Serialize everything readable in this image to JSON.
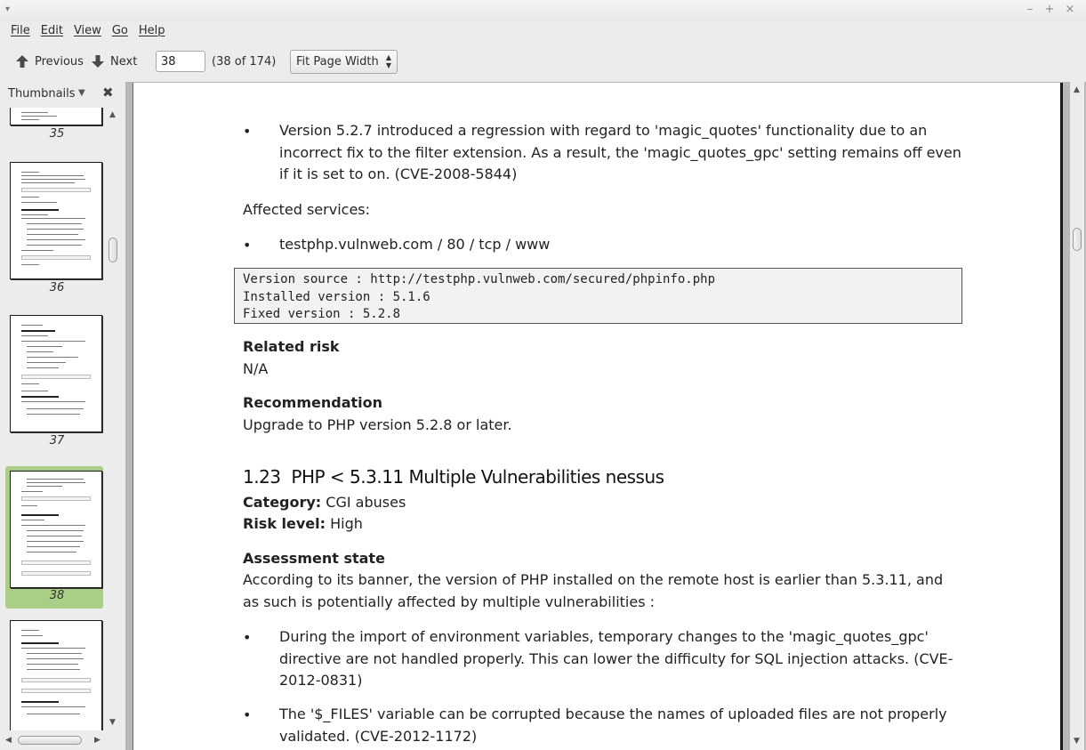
{
  "window": {
    "menu_glyph": "▾",
    "minimize": "–",
    "maximize": "+",
    "close": "×"
  },
  "menu": [
    "File",
    "Edit",
    "View",
    "Go",
    "Help"
  ],
  "toolbar": {
    "previous_label": "Previous",
    "next_label": "Next",
    "page_value": "38",
    "page_count": "(38 of 174)",
    "zoom": "Fit Page Width"
  },
  "sidebar": {
    "title": "Thumbnails",
    "thumbnails": [
      {
        "label": "35",
        "selected": false
      },
      {
        "label": "36",
        "selected": false
      },
      {
        "label": "37",
        "selected": false
      },
      {
        "label": "38",
        "selected": true
      },
      {
        "label": "",
        "selected": false
      }
    ]
  },
  "document": {
    "bullet": "•",
    "bullet1": "Version 5.2.7 introduced a regression with regard to 'magic_quotes' functionality due to an incorrect fix to the filter extension. As a result, the 'magic_quotes_gpc' setting remains off even if it is set to on. (CVE-2008-5844)",
    "affected_services": "Affected services:",
    "service": "testphp.vulnweb.com / 80 / tcp / www",
    "code": [
      "Version source : http://testphp.vulnweb.com/secured/phpinfo.php",
      "Installed version : 5.1.6",
      "Fixed version : 5.2.8"
    ],
    "related_risk_label": "Related risk",
    "related_risk_value": "N/A",
    "recommendation_label": "Recommendation",
    "recommendation_value": "Upgrade to PHP version 5.2.8 or later.",
    "section_number": "1.23",
    "section_title": "PHP < 5.3.11 Multiple Vulnerabilities nessus",
    "category_label": "Category:",
    "category_value": "CGI abuses",
    "risk_level_label": "Risk level:",
    "risk_level_value": "High",
    "assessment_label": "Assessment state",
    "assessment_text": "According to its banner, the version of PHP installed on the remote host is earlier than 5.3.11, and as such is potentially affected by multiple vulnerabilities :",
    "bullet2": "During the import of environment variables, temporary changes to the 'magic_quotes_gpc' directive are not handled properly. This can lower the difficulty for SQL injection attacks. (CVE-2012-0831)",
    "bullet3": "The '$_FILES' variable can be corrupted because the names of uploaded files are not properly validated. (CVE-2012-1172)"
  }
}
